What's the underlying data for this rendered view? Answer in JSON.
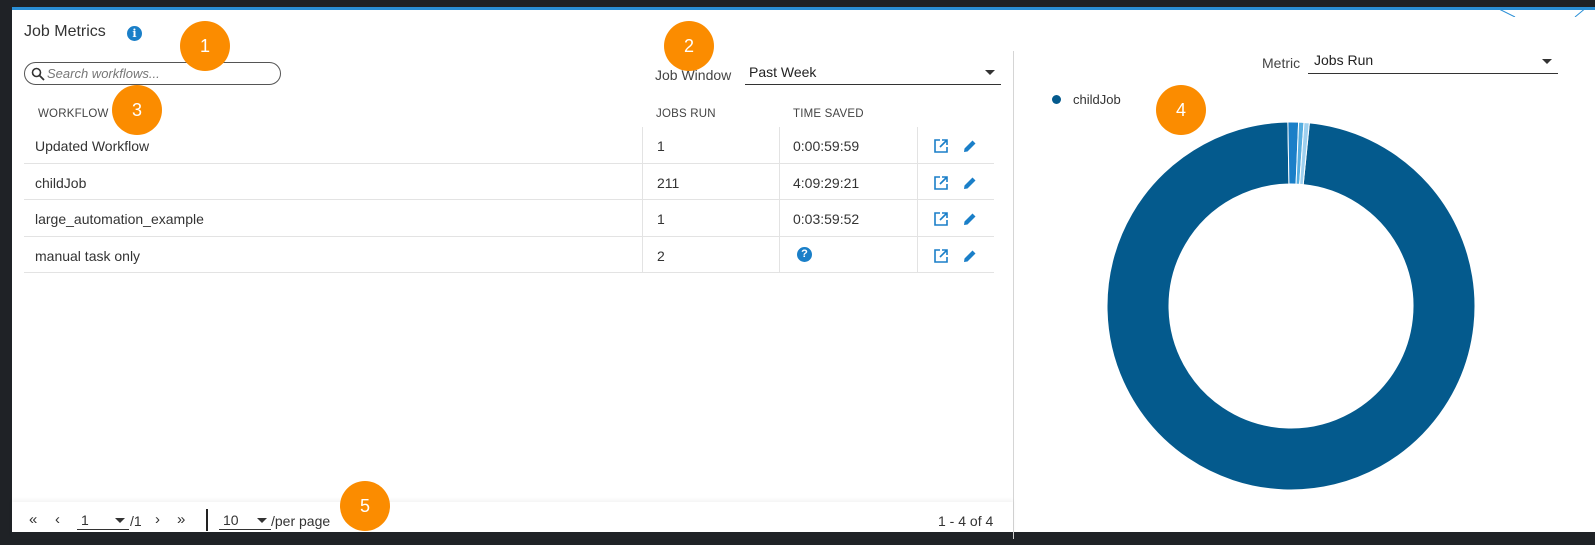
{
  "panel": {
    "title": "Job Metrics"
  },
  "search": {
    "placeholder": "Search workflows..."
  },
  "job_window": {
    "label": "Job Window",
    "value": "Past Week"
  },
  "metric": {
    "label": "Metric",
    "value": "Jobs Run"
  },
  "table": {
    "headers": [
      "WORKFLOW",
      "JOBS RUN",
      "TIME SAVED"
    ],
    "rows": [
      {
        "workflow": "Updated Workflow",
        "jobs_run": "1",
        "time_saved": "0:00:59:59"
      },
      {
        "workflow": "childJob",
        "jobs_run": "211",
        "time_saved": "4:09:29:21"
      },
      {
        "workflow": "large_automation_example",
        "jobs_run": "1",
        "time_saved": "0:03:59:52"
      },
      {
        "workflow": "manual task only",
        "jobs_run": "2",
        "time_saved": ""
      }
    ]
  },
  "chart": {
    "legend": [
      "childJob"
    ],
    "colors": [
      "#045a8d",
      "#1a7fc8",
      "#56aee0",
      "#9ed0ef"
    ]
  },
  "chart_data": {
    "type": "pie",
    "categories": [
      "childJob",
      "manual task only",
      "Updated Workflow",
      "large_automation_example"
    ],
    "values": [
      211,
      2,
      1,
      1
    ],
    "title": ""
  },
  "pagination": {
    "first": "«",
    "prev": "‹",
    "next": "›",
    "last": "»",
    "page": "1",
    "total_pages": "/1",
    "per_page": "10",
    "per_page_label": "/per page",
    "range": "1 - 4 of 4"
  },
  "badges": [
    "1",
    "2",
    "3",
    "4",
    "5"
  ],
  "icons": {
    "info": "info-icon",
    "help": "help-icon",
    "open": "open-in-new-icon",
    "edit": "pencil-icon",
    "search": "search-icon"
  }
}
